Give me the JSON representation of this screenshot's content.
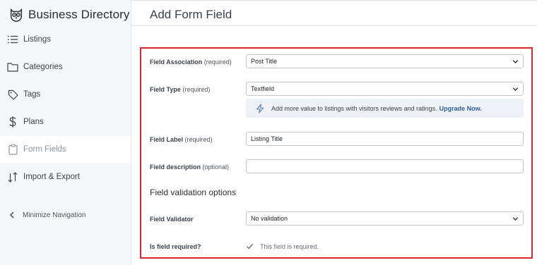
{
  "app": {
    "title": "Business Directory"
  },
  "nav": {
    "items": [
      {
        "label": "Listings",
        "icon": "list-icon"
      },
      {
        "label": "Categories",
        "icon": "folder-icon"
      },
      {
        "label": "Tags",
        "icon": "tag-icon"
      },
      {
        "label": "Plans",
        "icon": "dollar-icon"
      },
      {
        "label": "Form Fields",
        "icon": "clipboard-icon",
        "active": true
      },
      {
        "label": "Import & Export",
        "icon": "arrows-updown-icon"
      }
    ],
    "minimize_label": "Minimize Navigation"
  },
  "page": {
    "title": "Add Form Field"
  },
  "form": {
    "field_association": {
      "label": "Field Association",
      "req": "(required)",
      "value": "Post Title"
    },
    "field_type": {
      "label": "Field Type",
      "req": "(required)",
      "value": "Textfield"
    },
    "notice": {
      "text": "Add more value to listings with visitors reviews and ratings.",
      "link": "Upgrade Now."
    },
    "field_label": {
      "label": "Field Label",
      "req": "(required)",
      "value": "Listing Title"
    },
    "field_description": {
      "label": "Field description",
      "req": "(optional)",
      "value": ""
    },
    "validation_section": "Field validation options",
    "field_validator": {
      "label": "Field Validator",
      "value": "No validation"
    },
    "is_required": {
      "label": "Is field required?",
      "checkbox_text": "This field is required.",
      "checked": true
    }
  },
  "colors": {
    "highlight": "#d9262c",
    "link": "#2f5d96",
    "active_nav_text": "#8c95a0"
  }
}
